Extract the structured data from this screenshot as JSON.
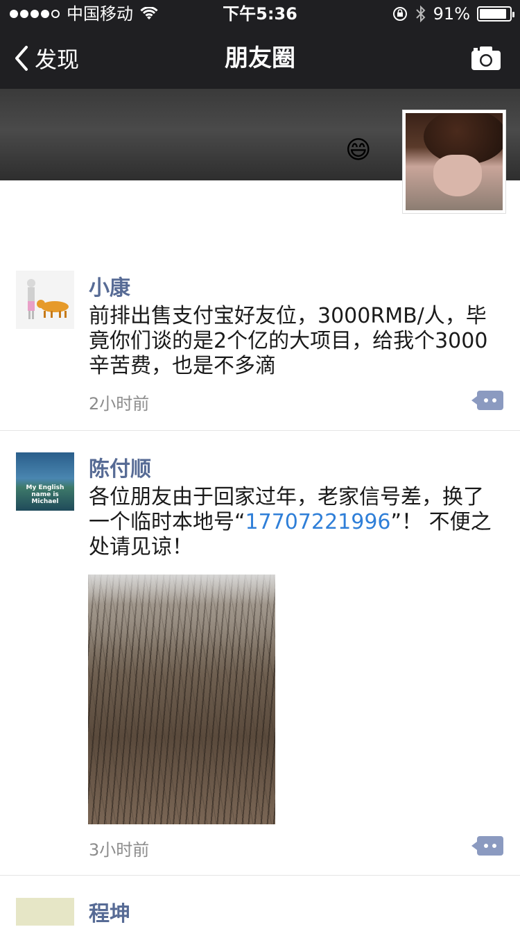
{
  "status_bar": {
    "carrier": "中国移动",
    "time": "下午5:36",
    "battery_percent": "91%",
    "battery_level": 0.91,
    "signal_icon": "signal-dots-icon",
    "wifi_icon": "wifi-icon",
    "lock_icon": "rotation-lock-icon",
    "bluetooth_icon": "bluetooth-icon"
  },
  "nav": {
    "back_label": "发现",
    "title": "朋友圈",
    "camera_icon": "camera-icon"
  },
  "cover": {
    "emoji": "😄"
  },
  "posts": [
    {
      "name": "小康",
      "text": "前排出售支付宝好友位，3000RMB/人，毕竟你们谈的是2个亿的大项目，给我个3000辛苦费，也是不多滴",
      "time": "2小时前"
    },
    {
      "name": "陈付顺",
      "text_before": "各位朋友由于回家过年，老家信号差，换了一个临时本地号“",
      "phone": "17707221996",
      "text_after": "”！ 不便之处请见谅！",
      "time": "3小时前",
      "avatar_text": "My English name is Michael"
    },
    {
      "name": "程坤"
    }
  ],
  "colors": {
    "nav_bg": "#1f1f22",
    "name_color": "#576b95",
    "link_color": "#2f7fd8",
    "comment_btn": "#8b9ac0"
  }
}
